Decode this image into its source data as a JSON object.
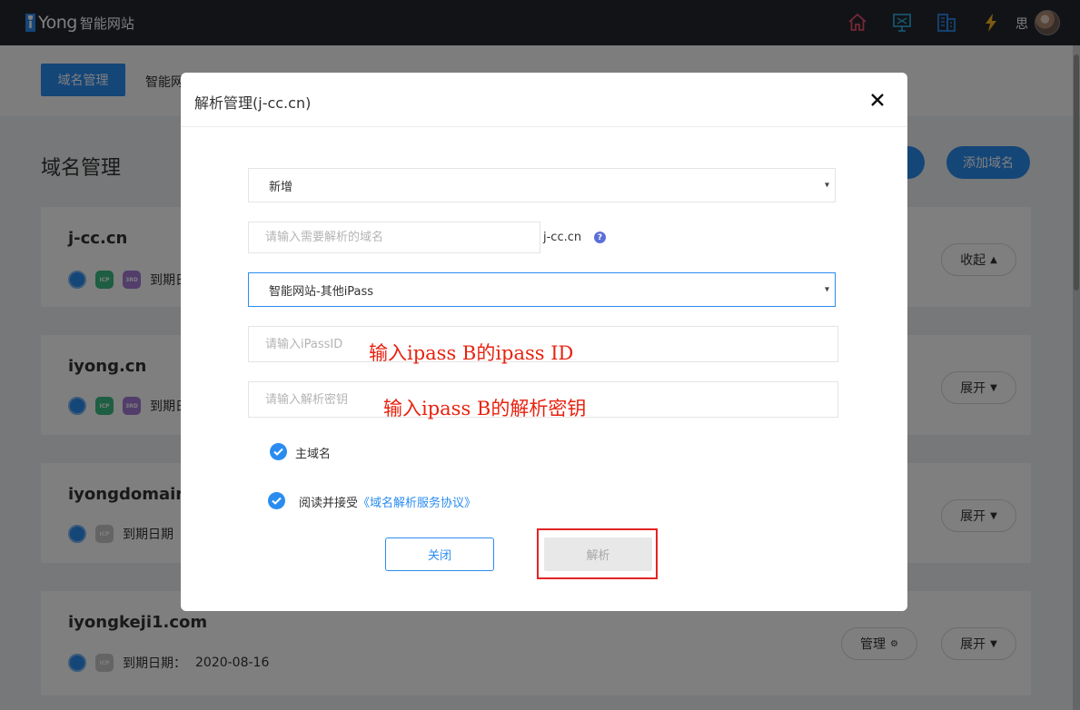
{
  "header": {
    "logo_i": "i",
    "logo_text": "Yong",
    "logo_sub": "智能网站",
    "user_name": "思",
    "icons": [
      "home-icon",
      "monitor-icon",
      "building-icon",
      "lightning-icon"
    ],
    "icon_colors": {
      "home": "#e8506a",
      "monitor": "#2fa8d8",
      "building": "#2a8cf0",
      "lightning": "#f5b623"
    }
  },
  "subnav": {
    "active_tab": "域名管理",
    "second_tab": "智能网"
  },
  "page": {
    "title": "域名管理",
    "add_button": "添加域名"
  },
  "domains": [
    {
      "name": "j-cc.cn",
      "expiry_label": "到期日",
      "toggle_label": "收起",
      "toggle_dir": "up"
    },
    {
      "name": "iyong.cn",
      "expiry_label": "到期日",
      "toggle_label": "展开",
      "toggle_dir": "down"
    },
    {
      "name": "iyongdomain.",
      "expiry_label": "到期日期",
      "toggle_label": "展开",
      "toggle_dir": "down"
    },
    {
      "name": "iyongkeji1.com",
      "expiry_label": "到期日期：",
      "expiry_value": "2020-08-16",
      "manage_label": "管理",
      "toggle_label": "展开",
      "toggle_dir": "down"
    }
  ],
  "modal": {
    "title": "解析管理(j-cc.cn)",
    "type_select": "新增",
    "domain_placeholder": "请输入需要解析的域名",
    "domain_suffix": "j-cc.cn",
    "help": "?",
    "target_select": "智能网站-其他iPass",
    "ipass_id_placeholder": "请输入iPassID",
    "secret_placeholder": "请输入解析密钥",
    "annotation_id": "输入ipass B的ipass ID",
    "annotation_secret": "输入ipass B的解析密钥",
    "main_domain_label": "主域名",
    "agree_prefix": "阅读并接受",
    "agree_link": "《域名解析服务协议》",
    "close_button": "关闭",
    "resolve_button": "解析"
  },
  "colors": {
    "accent": "#2a8cf0",
    "topbar": "#24272e",
    "annotation": "#e8220f",
    "highlight": "#e32424"
  }
}
